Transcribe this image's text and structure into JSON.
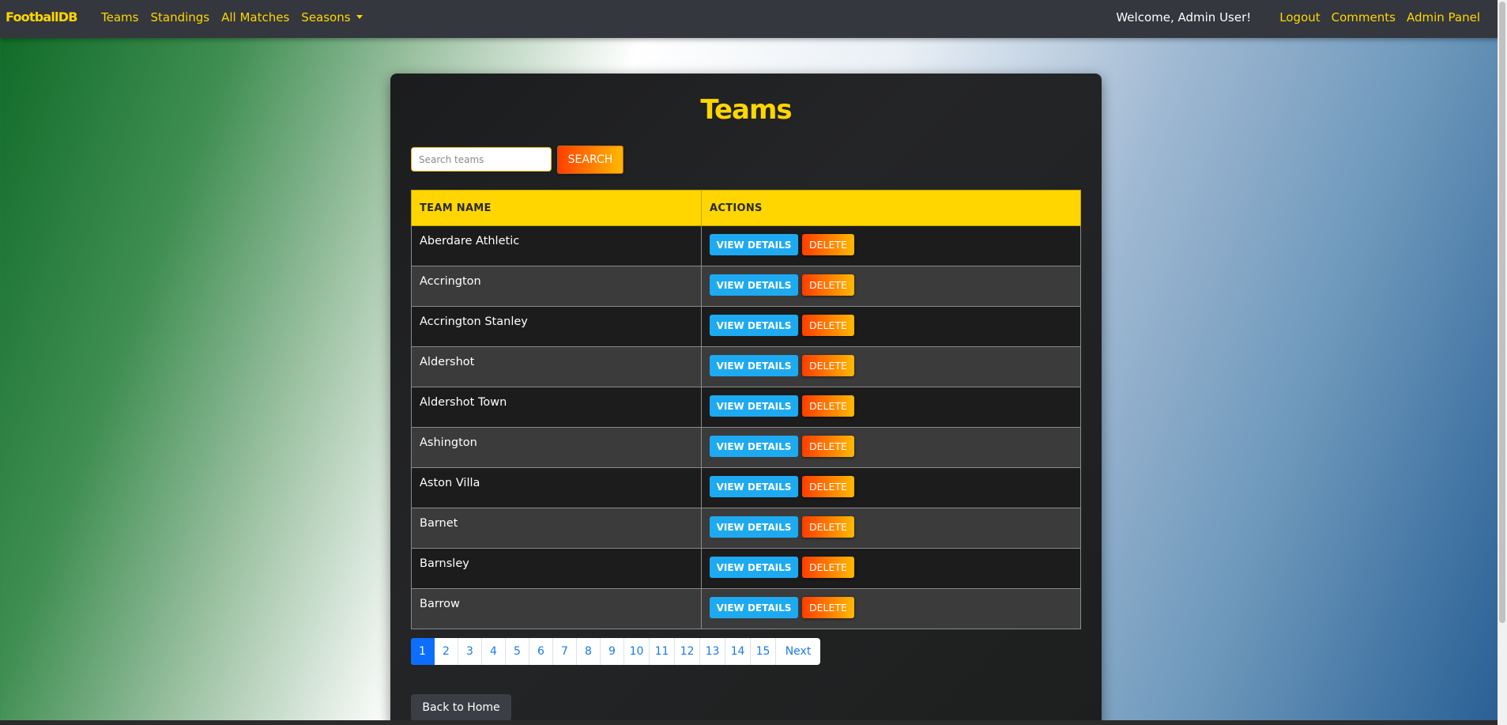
{
  "nav": {
    "brand": "FootballDB",
    "links": [
      "Teams",
      "Standings",
      "All Matches"
    ],
    "seasons": "Seasons",
    "welcome": "Welcome, Admin User!",
    "logout": "Logout",
    "comments": "Comments",
    "admin_panel": "Admin Panel"
  },
  "page": {
    "title": "Teams",
    "search_placeholder": "Search teams",
    "search_button": "SEARCH",
    "back_button": "Back to Home"
  },
  "table": {
    "headers": [
      "TEAM NAME",
      "ACTIONS"
    ],
    "view_label": "VIEW DETAILS",
    "delete_label": "DELETE",
    "rows": [
      "Aberdare Athletic",
      "Accrington",
      "Accrington Stanley",
      "Aldershot",
      "Aldershot Town",
      "Ashington",
      "Aston Villa",
      "Barnet",
      "Barnsley",
      "Barrow"
    ]
  },
  "pagination": {
    "pages": [
      "1",
      "2",
      "3",
      "4",
      "5",
      "6",
      "7",
      "8",
      "9",
      "10",
      "11",
      "12",
      "13",
      "14",
      "15"
    ],
    "current": "1",
    "next_label": "Next"
  },
  "colors": {
    "accent_yellow": "#ffd600",
    "view_button": "#1eaaf1",
    "delete_gradient_start": "#ff3d00",
    "delete_gradient_end": "#ffb300",
    "navbar": "#34373e",
    "page_active": "#0d6efd"
  }
}
